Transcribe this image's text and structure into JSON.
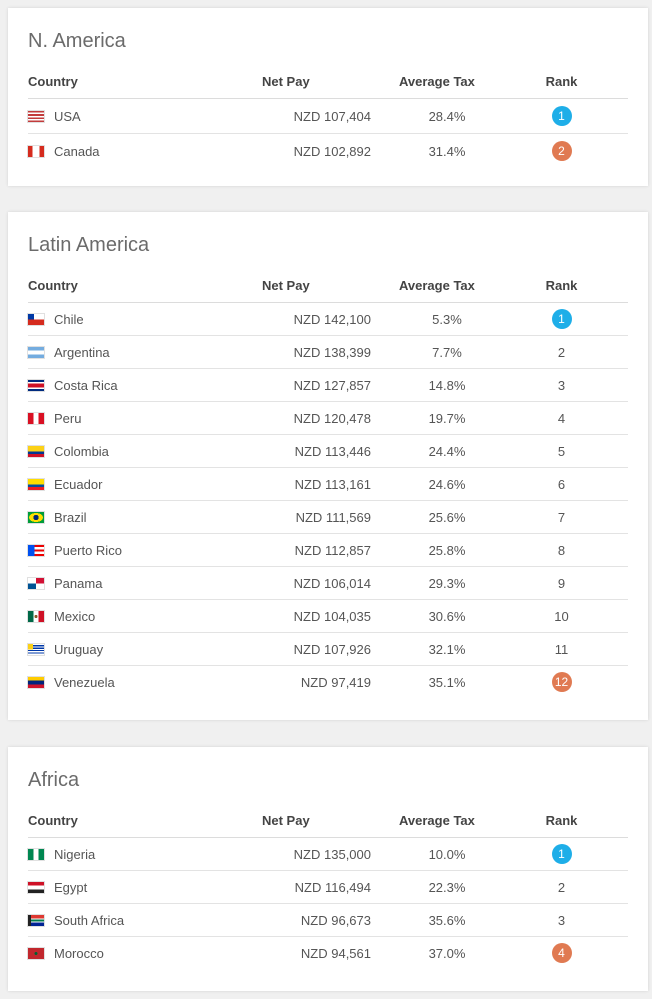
{
  "columns": {
    "country": "Country",
    "net": "Net Pay",
    "tax": "Average Tax",
    "rank": "Rank"
  },
  "regions": [
    {
      "title": "N. America",
      "rows": [
        {
          "country": "USA",
          "net": "NZD 107,404",
          "tax": "28.4%",
          "rank": "1",
          "flag": "usa",
          "badge": "top"
        },
        {
          "country": "Canada",
          "net": "NZD 102,892",
          "tax": "31.4%",
          "rank": "2",
          "flag": "canada",
          "badge": "bottom"
        }
      ]
    },
    {
      "title": "Latin America",
      "rows": [
        {
          "country": "Chile",
          "net": "NZD 142,100",
          "tax": "5.3%",
          "rank": "1",
          "flag": "chile",
          "badge": "top"
        },
        {
          "country": "Argentina",
          "net": "NZD 138,399",
          "tax": "7.7%",
          "rank": "2",
          "flag": "argentina",
          "badge": ""
        },
        {
          "country": "Costa Rica",
          "net": "NZD 127,857",
          "tax": "14.8%",
          "rank": "3",
          "flag": "costa-rica",
          "badge": ""
        },
        {
          "country": "Peru",
          "net": "NZD 120,478",
          "tax": "19.7%",
          "rank": "4",
          "flag": "peru",
          "badge": ""
        },
        {
          "country": "Colombia",
          "net": "NZD 113,446",
          "tax": "24.4%",
          "rank": "5",
          "flag": "colombia",
          "badge": ""
        },
        {
          "country": "Ecuador",
          "net": "NZD 113,161",
          "tax": "24.6%",
          "rank": "6",
          "flag": "ecuador",
          "badge": ""
        },
        {
          "country": "Brazil",
          "net": "NZD 111,569",
          "tax": "25.6%",
          "rank": "7",
          "flag": "brazil",
          "badge": ""
        },
        {
          "country": "Puerto Rico",
          "net": "NZD 112,857",
          "tax": "25.8%",
          "rank": "8",
          "flag": "puerto-rico",
          "badge": ""
        },
        {
          "country": "Panama",
          "net": "NZD 106,014",
          "tax": "29.3%",
          "rank": "9",
          "flag": "panama",
          "badge": ""
        },
        {
          "country": "Mexico",
          "net": "NZD 104,035",
          "tax": "30.6%",
          "rank": "10",
          "flag": "mexico",
          "badge": ""
        },
        {
          "country": "Uruguay",
          "net": "NZD 107,926",
          "tax": "32.1%",
          "rank": "11",
          "flag": "uruguay",
          "badge": ""
        },
        {
          "country": "Venezuela",
          "net": "NZD 97,419",
          "tax": "35.1%",
          "rank": "12",
          "flag": "venezuela",
          "badge": "bottom"
        }
      ]
    },
    {
      "title": "Africa",
      "rows": [
        {
          "country": "Nigeria",
          "net": "NZD 135,000",
          "tax": "10.0%",
          "rank": "1",
          "flag": "nigeria",
          "badge": "top"
        },
        {
          "country": "Egypt",
          "net": "NZD 116,494",
          "tax": "22.3%",
          "rank": "2",
          "flag": "egypt",
          "badge": ""
        },
        {
          "country": "South Africa",
          "net": "NZD 96,673",
          "tax": "35.6%",
          "rank": "3",
          "flag": "south-africa",
          "badge": ""
        },
        {
          "country": "Morocco",
          "net": "NZD 94,561",
          "tax": "37.0%",
          "rank": "4",
          "flag": "morocco",
          "badge": "bottom"
        }
      ]
    }
  ],
  "colors": {
    "top_badge": "#1eaee8",
    "bottom_badge": "#e07a52"
  }
}
